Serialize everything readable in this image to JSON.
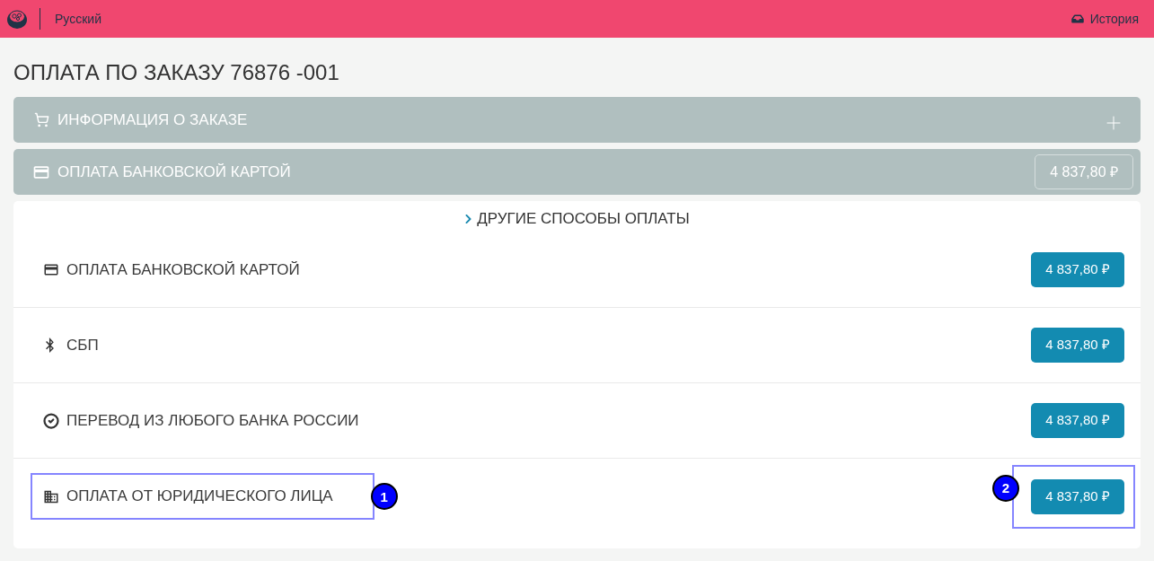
{
  "top_bar": {
    "language": "Русский",
    "history_link": "История"
  },
  "page_title": "ОПЛАТА ПО ЗАКАЗУ 76876 -001",
  "sections": [
    {
      "kind": "order",
      "title": "ИНФОРМАЦИЯ О ЗАКАЗЕ",
      "expanded": false
    },
    {
      "kind": "card",
      "title": "ОПЛАТА БАНКОВСКОЙ КАРТОЙ",
      "amount": "4 837,80 ₽"
    }
  ],
  "other_methods": {
    "toggle": "ДРУГИЕ СПОСОБЫ ОПЛАТЫ",
    "methods": [
      {
        "kind": "card",
        "label": "ОПЛАТА БАНКОВСКОЙ КАРТОЙ",
        "amount": "4 837,80 ₽"
      },
      {
        "kind": "sbp",
        "label": "СБП",
        "amount": "4 837,80 ₽"
      },
      {
        "kind": "transfer",
        "label": "ПЕРЕВОД ИЗ ЛЮБОГО БАНКА РОССИИ",
        "amount": "4 837,80 ₽"
      },
      {
        "kind": "company",
        "label": "ОПЛАТА ОТ ЮРИДИЧЕСКОГО ЛИЦА",
        "amount": "4 837,80 ₽",
        "label_marker": "1",
        "button_marker": "2"
      }
    ]
  }
}
